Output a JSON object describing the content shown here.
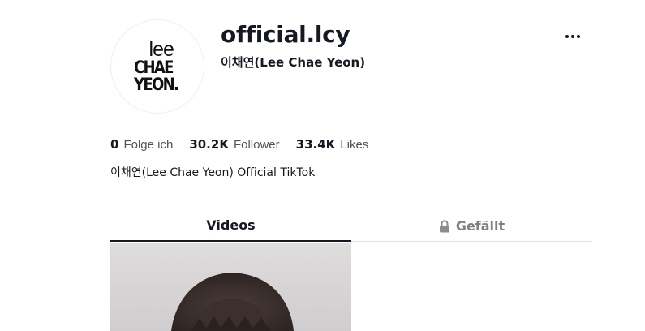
{
  "profile": {
    "username": "official.lcy",
    "nickname": "이채연(Lee Chae Yeon)",
    "bio": "이채연(Lee Chae Yeon) Official TikTok",
    "avatar_logo": {
      "line1": "lee",
      "line2": "CHAE",
      "line3": "YEON."
    }
  },
  "stats": [
    {
      "value": "0",
      "label": "Folge ich"
    },
    {
      "value": "30.2K",
      "label": "Follower"
    },
    {
      "value": "33.4K",
      "label": "Likes"
    }
  ],
  "tabs": [
    {
      "label": "Videos",
      "active": true
    },
    {
      "label": "Gefällt",
      "active": false,
      "icon": "lock-icon"
    }
  ],
  "icons": {
    "more": "more-options-icon",
    "lock": "lock-icon"
  },
  "colors": {
    "text_primary": "#161823",
    "text_secondary": "#73757b",
    "divider": "#e3e3e4"
  }
}
